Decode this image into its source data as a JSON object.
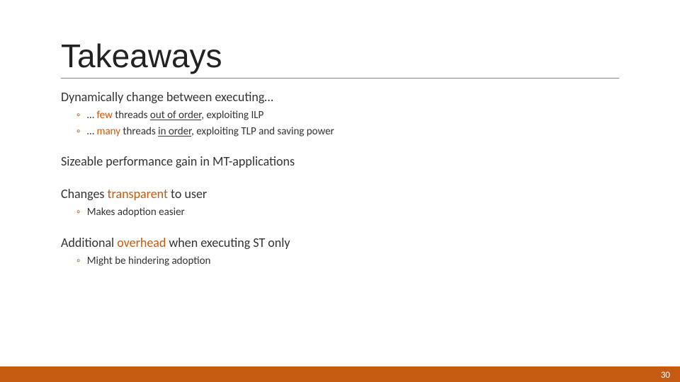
{
  "title": "Takeaways",
  "p1": {
    "text": "Dynamically change between executing…",
    "sub1": {
      "pre": "… ",
      "orange": "few",
      "mid": " threads ",
      "u": "out of order",
      "post": ", exploiting ILP"
    },
    "sub2": {
      "pre": "… ",
      "orange": "many",
      "mid": " threads ",
      "u": "in order",
      "post": ", exploiting TLP and saving power"
    }
  },
  "p2": {
    "text": "Sizeable performance gain in MT-applications"
  },
  "p3": {
    "pre": "Changes ",
    "orange": "transparent",
    "post": " to user",
    "sub1": "Makes adoption easier"
  },
  "p4": {
    "pre": "Additional ",
    "orange": "overhead",
    "post": " when executing ST only",
    "sub1": "Might be hindering adoption"
  },
  "pageNumber": "30",
  "bulletMarker": "◦"
}
